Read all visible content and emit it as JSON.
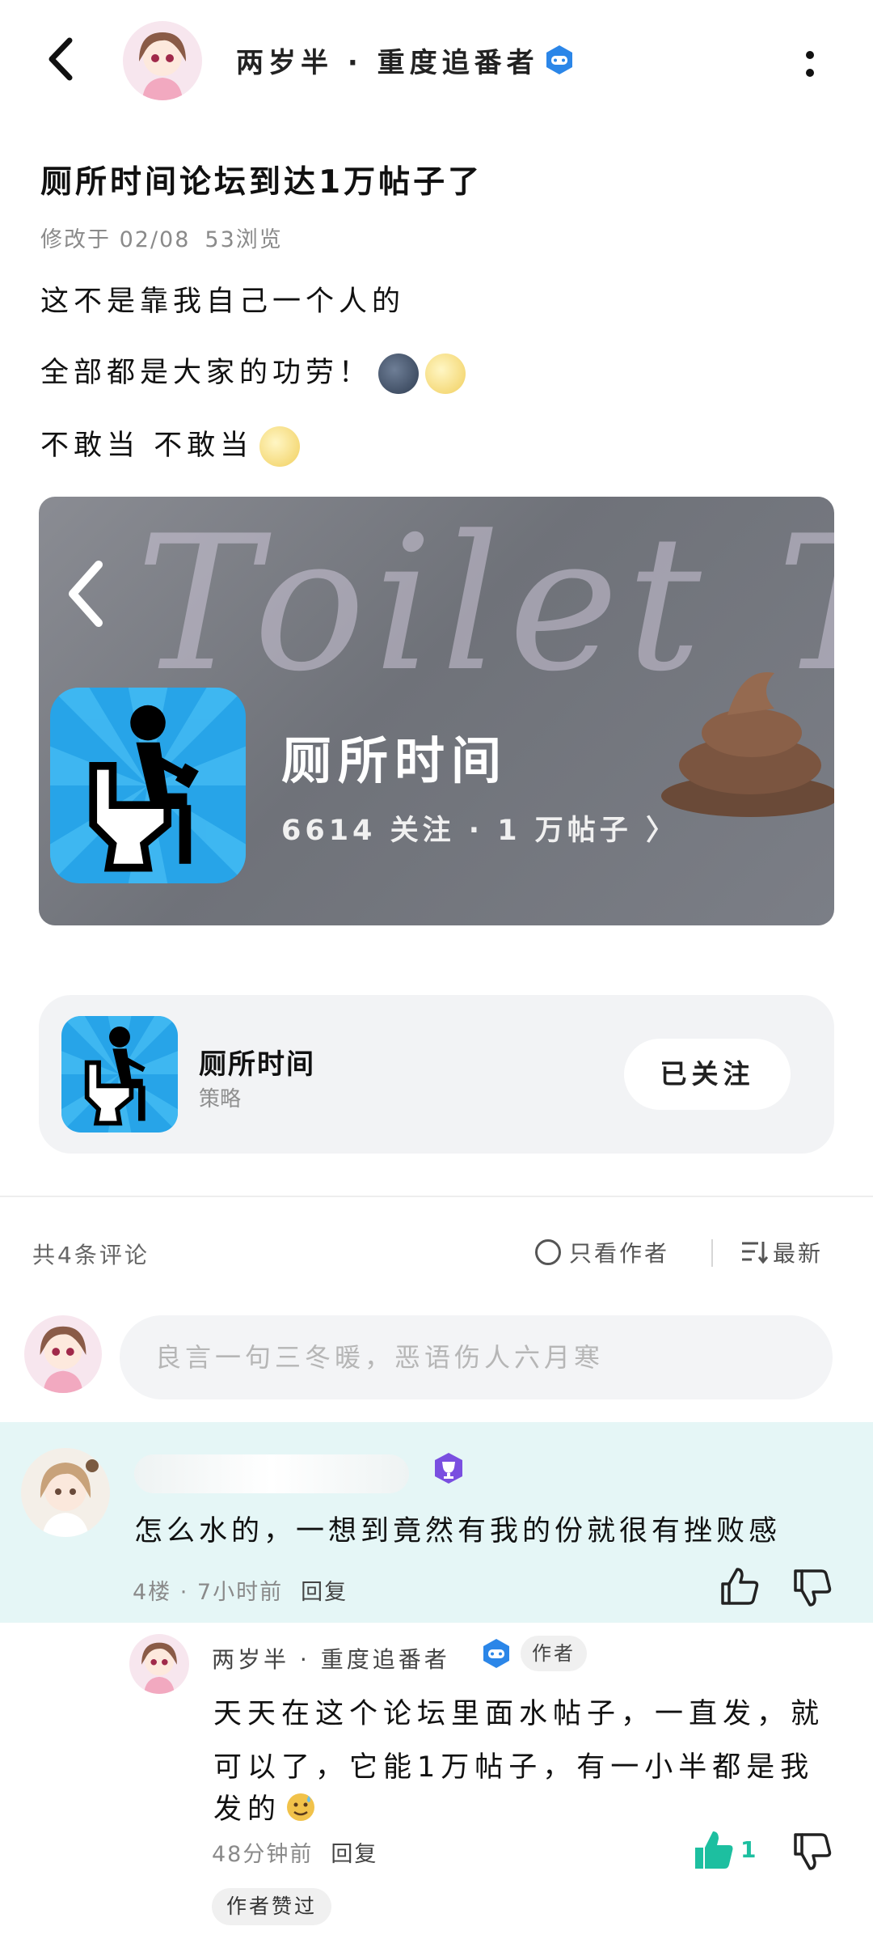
{
  "header": {
    "author_name": "两岁半 · 重度追番者",
    "verify_icon": "gamepad-badge-icon",
    "more_icon": "more-vertical-icon",
    "back_icon": "back-arrow-icon"
  },
  "post": {
    "title": "厕所时间论坛到达1万帖子了",
    "modified": "修改于 02/08",
    "views": "53浏览",
    "body_lines": [
      "这不是靠我自己一个人的",
      "全部都是大家的功劳！",
      "不敢当 不敢当"
    ],
    "emoji_icons": [
      "new-moon-face-icon",
      "full-moon-face-icon"
    ]
  },
  "banner": {
    "script_text": "Toilet T",
    "forum_name": "厕所时间",
    "stats": "6614 关注 · 1 万帖子 〉"
  },
  "forum_card": {
    "name": "厕所时间",
    "category": "策略",
    "follow_label": "已关注"
  },
  "comments_bar": {
    "count_label": "共4条评论",
    "only_author_label": "只看作者",
    "sort_label": "最新"
  },
  "composer": {
    "placeholder": "良言一句三冬暖，恶语伤人六月寒"
  },
  "comment1": {
    "text": "怎么水的，一想到竟然有我的份就很有挫败感",
    "floor": "4楼 · 7小时前",
    "reply_label": "回复",
    "badge_icon": "trophy-badge-icon"
  },
  "reply1": {
    "author_name": "两岁半 · 重度追番者",
    "author_tag": "作者",
    "lines": [
      "天天在这个论坛里面水帖子，一直发，就",
      "可以了，它能1万帖子，有一小半都是我",
      "发的"
    ],
    "time": "48分钟前",
    "reply_label": "回复",
    "like_count": "1",
    "liked_by_author": "作者赞过"
  },
  "colors": {
    "accent": "#1dbfa0",
    "highlight_bg": "#e5f6f6",
    "badge_blue": "#2b86e8",
    "trophy_purple": "#7a4fe0"
  }
}
